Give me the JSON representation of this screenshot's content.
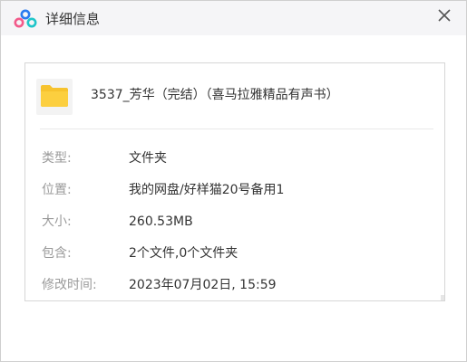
{
  "window": {
    "title": "详细信息",
    "app_icon": "baidu-netdisk-cloud-icon",
    "close_icon": "close-icon"
  },
  "file": {
    "icon": "folder-icon",
    "name": "3537_芳华（完结）（喜马拉雅精品有声书）"
  },
  "details": [
    {
      "label": "类型:",
      "value": "文件夹"
    },
    {
      "label": "位置:",
      "value": "我的网盘/好样猫20号备用1"
    },
    {
      "label": "大小:",
      "value": "260.53MB"
    },
    {
      "label": "包含:",
      "value": "2个文件,0个文件夹"
    },
    {
      "label": "修改时间:",
      "value": "2023年07月02日, 15:59"
    }
  ],
  "colors": {
    "folder": "#f7c32e",
    "label": "#9a9a9a",
    "text": "#333333",
    "logo_blue": "#2b7bf0",
    "logo_pink": "#f25a8a",
    "logo_teal": "#1fc5c9"
  }
}
